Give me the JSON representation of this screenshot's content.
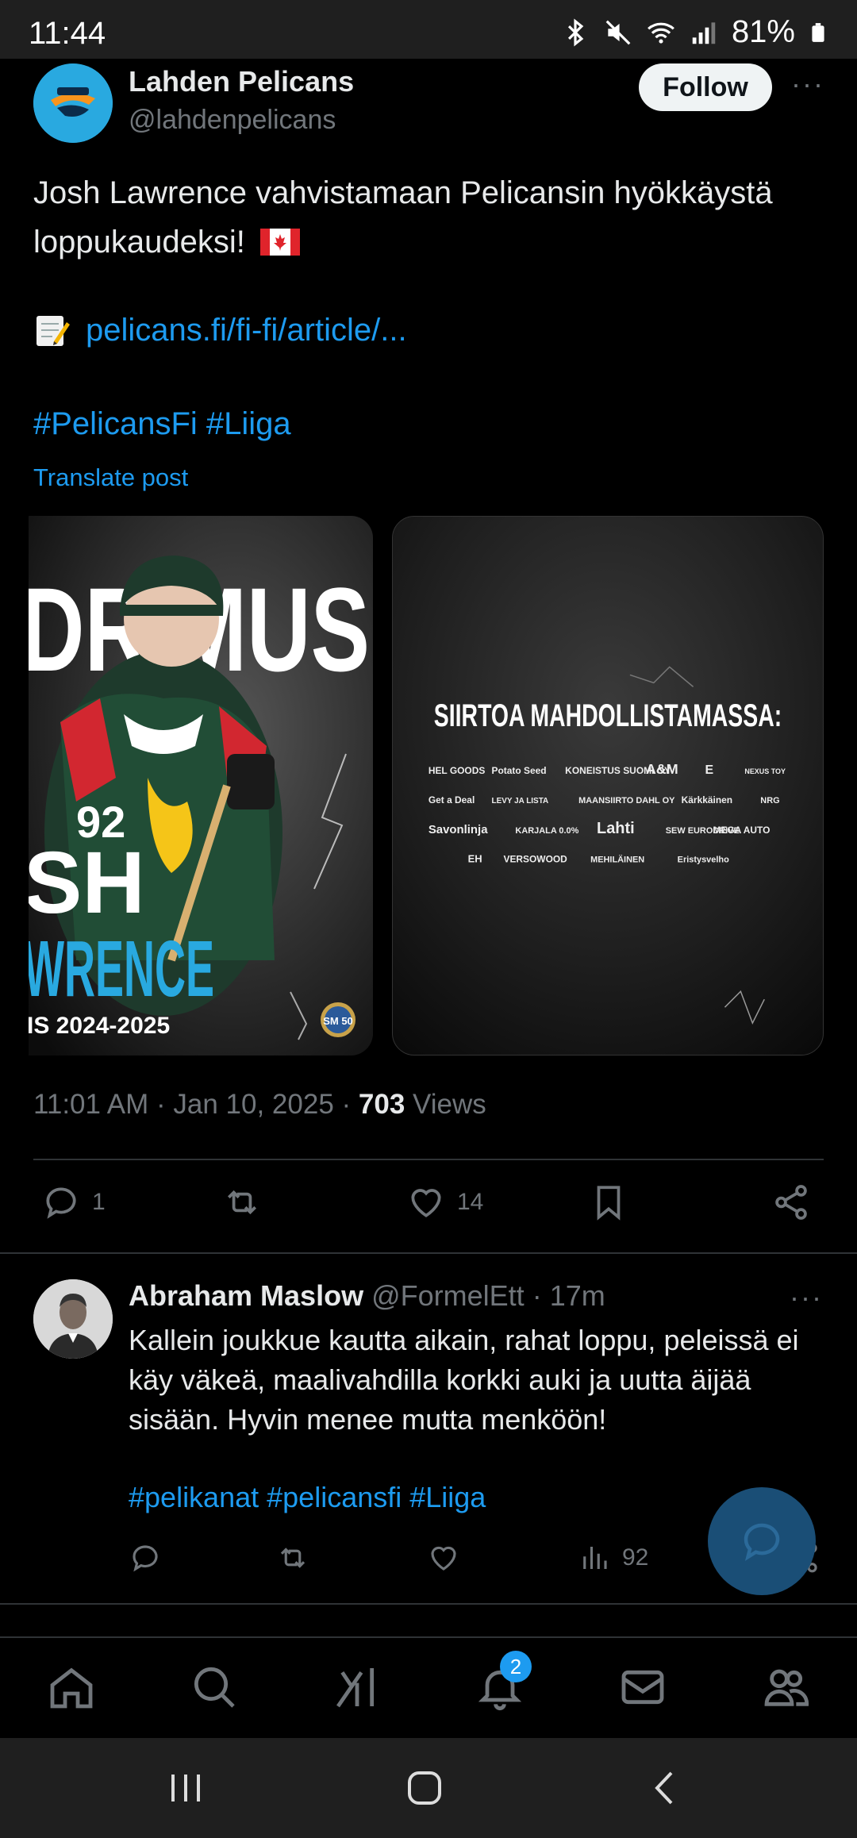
{
  "status_bar": {
    "time": "11:44",
    "battery": "81%"
  },
  "tweet": {
    "author_name": "Lahden Pelicans",
    "author_handle": "@lahdenpelicans",
    "follow_label": "Follow",
    "more": "···",
    "text": "Josh Lawrence vahvistamaan Pelicansin hyökkäystä loppukaudeksi!",
    "link": "pelicans.fi/fi-fi/article/...",
    "hashtags": "#PelicansFi #Liiga",
    "translate_label": "Translate post",
    "media1": {
      "headline_top": "DRIMUS",
      "name_first": "SH",
      "name_last": "WRENCE",
      "season": "IS 2024-2025",
      "jersey_number": "92",
      "badge": "SM 50"
    },
    "media2": {
      "headline": "SIIRTOA MAHDOLLISTAMASSA:",
      "sponsors_row1": [
        "HEL GOODS",
        "Potato Seed",
        "KONEISTUS SUOMI OY",
        "A&M",
        "E",
        "NEXUS TOY"
      ],
      "sponsors_row2": [
        "Get a Deal",
        "LEVY JA LISTA",
        "MAANSIIRTO DAHL OY",
        "Kärkkäinen",
        "NRG"
      ],
      "sponsors_row3": [
        "Savonlinja",
        "KARJALA 0.0%",
        "Lahti",
        "SEW EURODRIVE",
        "MEGA AUTO"
      ],
      "sponsors_row4": [
        "EH",
        "VERSOWOOD",
        "MEHILÄINEN",
        "Eristysvelho"
      ]
    },
    "time": "11:01 AM",
    "date": "Jan 10, 2025",
    "views_count": "703",
    "views_label": "Views",
    "reply_count": "1",
    "like_count": "14"
  },
  "reply": {
    "author_name": "Abraham Maslow",
    "author_handle": "@FormelEtt",
    "age": "17m",
    "more": "···",
    "text": "Kallein joukkue kautta aikain, rahat loppu, peleissä ei käy väkeä, maalivahdilla korkki auki ja uutta äijää sisään. Hyvin menee mutta menköön!",
    "hashtags": "#pelikanat #pelicansfi #Liiga",
    "views_count": "92"
  },
  "bottom_nav": {
    "notification_badge": "2"
  }
}
